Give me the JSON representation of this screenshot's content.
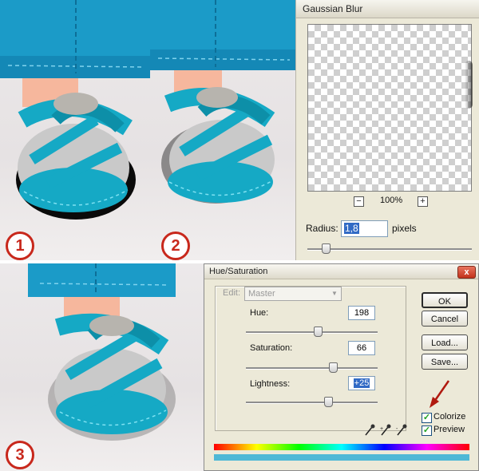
{
  "steps": {
    "one": "1",
    "two": "2",
    "three": "3"
  },
  "gaussian_blur": {
    "title": "Gaussian Blur",
    "zoom": "100%",
    "zoom_out": "−",
    "zoom_in": "+",
    "radius_label": "Radius:",
    "radius_value": "1,8",
    "units": "pixels",
    "radius_slider_fraction": 0.05
  },
  "hue_saturation": {
    "title": "Hue/Saturation",
    "close": "x",
    "edit_label": "Edit:",
    "edit_value": "Master",
    "hue_label": "Hue:",
    "hue_value": "198",
    "hue_slider_fraction": 0.55,
    "saturation_label": "Saturation:",
    "saturation_value": "66",
    "saturation_slider_fraction": 0.66,
    "lightness_label": "Lightness:",
    "lightness_value": "+25",
    "lightness_slider_fraction": 0.62,
    "buttons": {
      "ok": "OK",
      "cancel": "Cancel",
      "load": "Load...",
      "save": "Save..."
    },
    "colorize_label": "Colorize",
    "colorize_checked": true,
    "preview_label": "Preview",
    "preview_checked": true
  },
  "colors": {
    "accent_red": "#c8281c",
    "shoe_teal": "#14aac4",
    "pants_blue": "#1b8fc0",
    "selection_blue": "#316ac5"
  }
}
